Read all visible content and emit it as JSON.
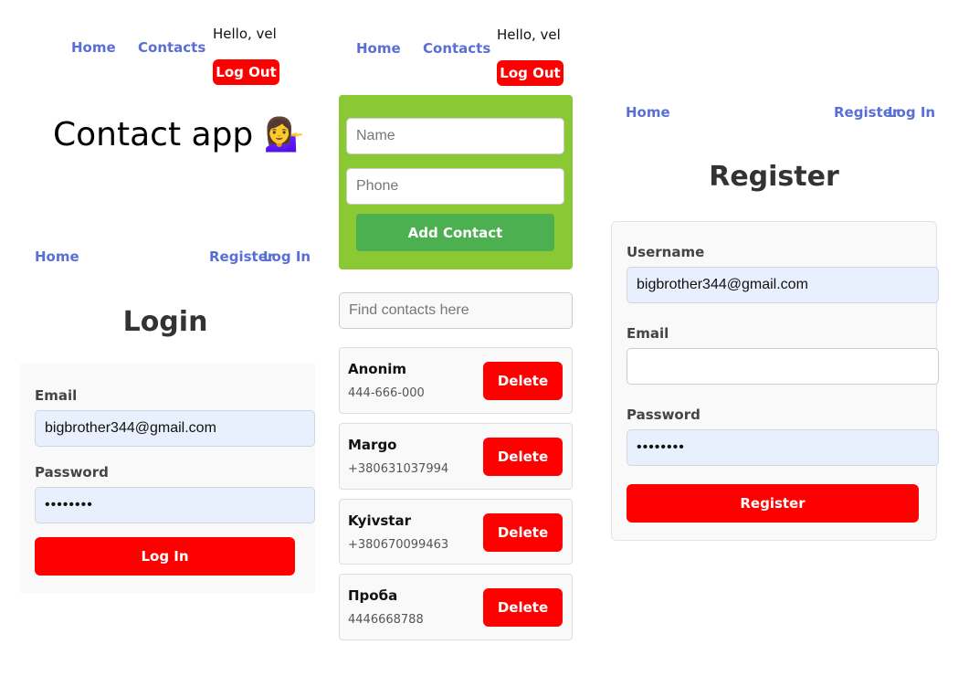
{
  "panel_home": {
    "nav": {
      "home": "Home",
      "contacts": "Contacts"
    },
    "greeting": "Hello, vel",
    "logout_label": "Log Out",
    "title": "Contact app 💁‍♀️"
  },
  "panel_login": {
    "nav": {
      "home": "Home",
      "register": "Register",
      "login": "Log In"
    },
    "title": "Login",
    "email_label": "Email",
    "email_value": "bigbrother344@gmail.com",
    "password_label": "Password",
    "password_value": "••••••••",
    "submit_label": "Log In"
  },
  "panel_contacts": {
    "nav": {
      "home": "Home",
      "contacts": "Contacts"
    },
    "greeting": "Hello, vel",
    "logout_label": "Log Out",
    "name_placeholder": "Name",
    "phone_placeholder": "Phone",
    "add_label": "Add Contact",
    "filter_placeholder": "Find contacts here",
    "delete_label": "Delete",
    "contacts": [
      {
        "name": "Anonim",
        "phone": "444-666-000"
      },
      {
        "name": "Margo",
        "phone": "+380631037994"
      },
      {
        "name": "Kyivstar",
        "phone": "+380670099463"
      },
      {
        "name": "Проба",
        "phone": "4446668788"
      }
    ]
  },
  "panel_register": {
    "nav": {
      "home": "Home",
      "register": "Register",
      "login": "Log In"
    },
    "title": "Register",
    "username_label": "Username",
    "username_value": "bigbrother344@gmail.com",
    "email_label": "Email",
    "email_value": "",
    "password_label": "Password",
    "password_value": "••••••••",
    "submit_label": "Register"
  },
  "colors": {
    "link": "#5a6fd6",
    "danger": "#ff0000",
    "form_panel": "#8ac933",
    "add_button": "#4caf50",
    "autofill": "#e8f0fe"
  }
}
